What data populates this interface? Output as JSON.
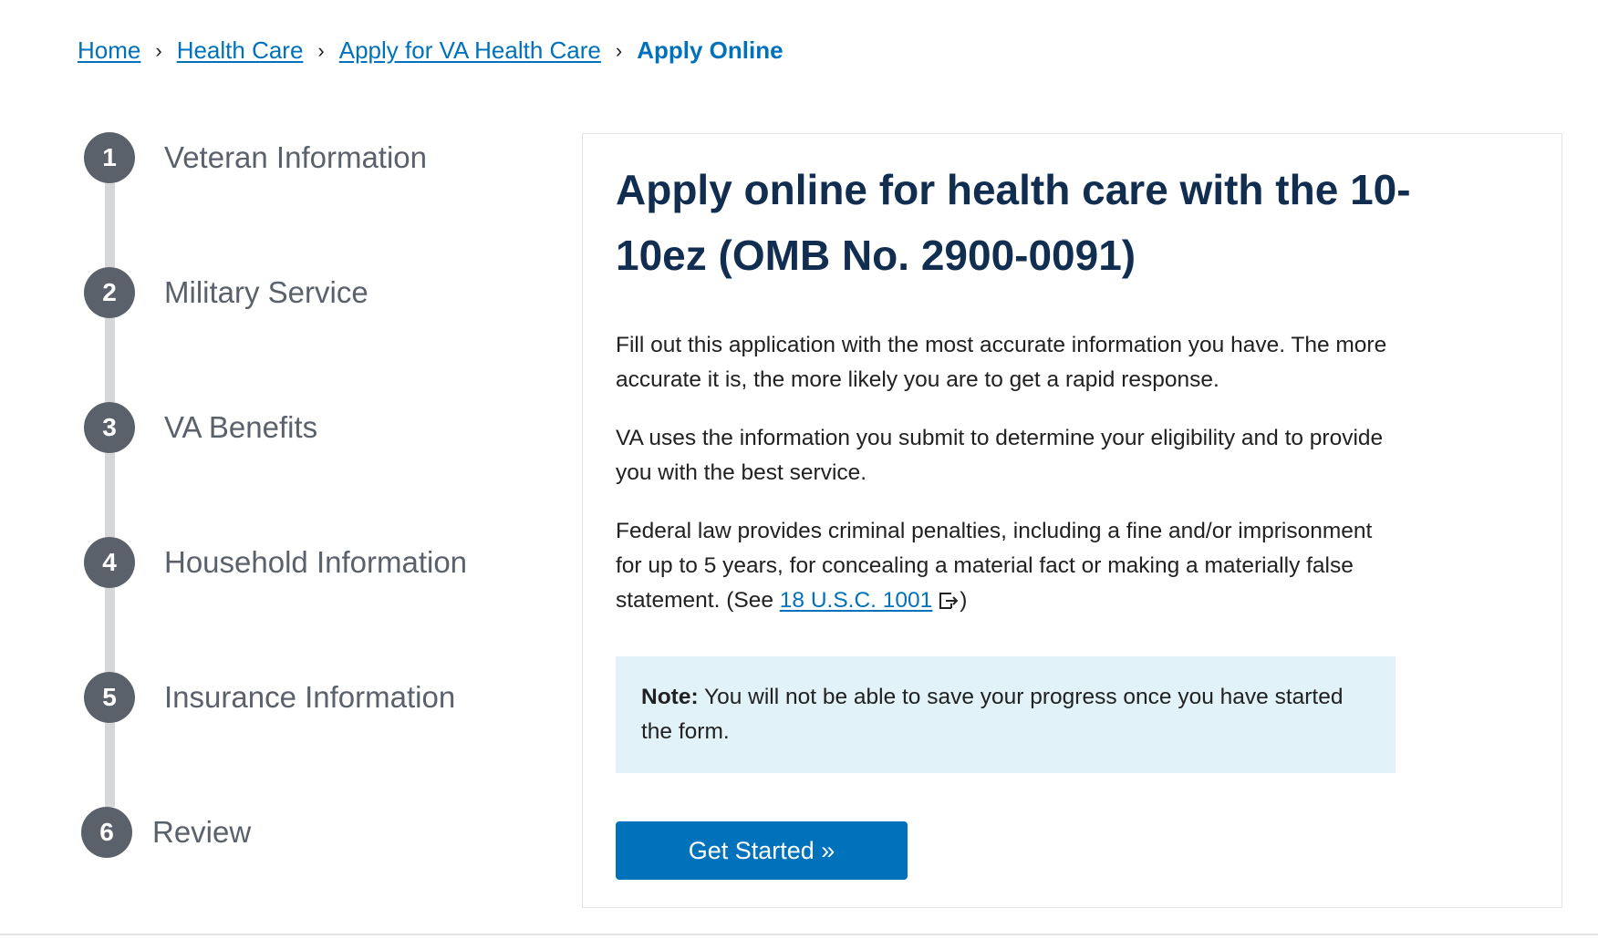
{
  "breadcrumb": {
    "items": [
      {
        "label": "Home"
      },
      {
        "label": "Health Care"
      },
      {
        "label": "Apply for VA Health Care"
      }
    ],
    "current": "Apply Online",
    "separator": "›"
  },
  "steps": [
    {
      "number": "1",
      "label": "Veteran Information"
    },
    {
      "number": "2",
      "label": "Military Service"
    },
    {
      "number": "3",
      "label": "VA Benefits"
    },
    {
      "number": "4",
      "label": "Household Information"
    },
    {
      "number": "5",
      "label": "Insurance Information"
    },
    {
      "number": "6",
      "label": "Review"
    }
  ],
  "intro": {
    "title": "Apply online for health care with the 10-10ez (OMB No. 2900-0091)",
    "paragraph1": "Fill out this application with the most accurate information you have. The more accurate it is, the more likely you are to get a rapid response.",
    "paragraph2": "VA uses the information you submit to determine your eligibility and to provide you with the best service.",
    "paragraph3_before": "Federal law provides criminal penalties, including a fine and/or imprisonment for up to 5 years, for concealing a material fact or making a materially false statement. (See ",
    "paragraph3_link": "18 U.S.C. 1001",
    "paragraph3_after": ")",
    "external_link_icon": "external-link-icon",
    "note_label": "Note:",
    "note_text": " You will not be able to save your progress once you have started the form.",
    "button_label": "Get Started »"
  },
  "colors": {
    "link": "#0071bb",
    "title": "#112e51",
    "step_circle": "#5b616b",
    "step_line": "#d6d7d9",
    "note_background": "#e1f3f8",
    "button": "#0071bb"
  }
}
